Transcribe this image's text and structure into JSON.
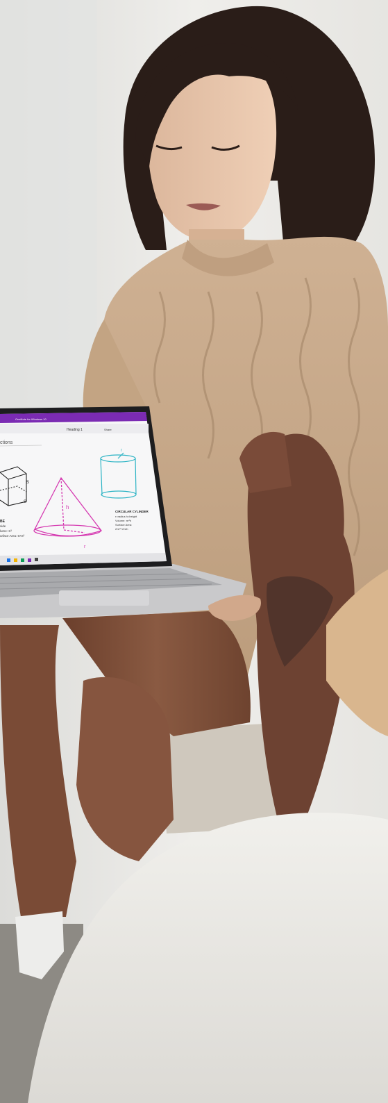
{
  "scene": {
    "background": "#e9e8e4",
    "sweater_color": "#c9ab8b",
    "skin_color": "#7a4b36",
    "hair_color": "#2a1d18",
    "laptop_color": "#c9c9cb",
    "screen_accent": "#7b2bb3"
  },
  "laptop_screen": {
    "window_title": "OneNote for Windows 10",
    "heading_style": "Heading 1",
    "share_label": "Share",
    "page_title_fragment": "ctions",
    "cone_height_label": "h",
    "cone_radius_label": "r",
    "cube_side_label_1": "S",
    "cube_side_label_2": "S",
    "cylinder_radius_label": "r",
    "cube_caption_line1": "BE",
    "cube_caption_line2": "side",
    "cube_caption_line3": "lume: S³",
    "cube_caption_line4": "urface Area: 6×S²",
    "cylinder_caption_title": "CIRCULAR CYLINDER",
    "cylinder_caption_line1": "r=radius  h=height",
    "cylinder_caption_line2": "Volume: πr²h",
    "cylinder_caption_line3": "Surface Area:",
    "cylinder_caption_line4": "2πr²+2πrh"
  }
}
